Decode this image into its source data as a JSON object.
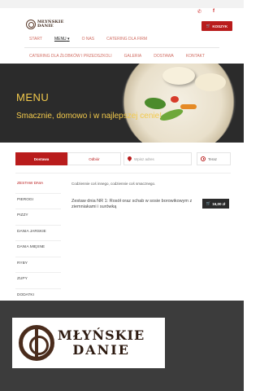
{
  "brand": {
    "logo_line1": "MŁYŃSKIE",
    "logo_line2": "DANIE"
  },
  "header": {
    "social": [
      "phone-icon",
      "facebook-icon"
    ],
    "cart_label": "KOSZYK"
  },
  "nav": {
    "row1": [
      "START",
      "MENU",
      "O NAS",
      "CATERING DLA FIRM"
    ],
    "row2": [
      "CATERING DLA ŻŁOBKÓW I PRZEDSZKOLI",
      "GALERIA",
      "DOSTAWA",
      "KONTAKT"
    ],
    "active": "MENU"
  },
  "hero": {
    "title": "MENU",
    "subtitle": "Smacznie, domowo i w najlepszej cenie!"
  },
  "order_form": {
    "delivery_tab": "Dostawa",
    "pickup_tab": "Odbiór",
    "address_placeholder": "Wpisz adres",
    "time_label": "Teraz"
  },
  "categories": [
    "ZESTAW DNIA",
    "PIEROGI",
    "PIZZY",
    "DANIA JARSKIE",
    "DANIA MIĘSNE",
    "RYBY",
    "ZUPY",
    "DODATKI",
    "NAPOJE"
  ],
  "active_category": "ZESTAW DNIA",
  "content": {
    "note": "Codziennie coś innego, codziennie coś smacznego.",
    "meal_name": "Zestaw dnia NR 1: Rosół oraz schab w sosie borowikowym z ziemniakami i surówką",
    "meal_price": "16,00 zł"
  },
  "colors": {
    "accent": "#b91c1c",
    "hero_text": "#f2c94c",
    "footer_bg": "#3c3c3c"
  }
}
